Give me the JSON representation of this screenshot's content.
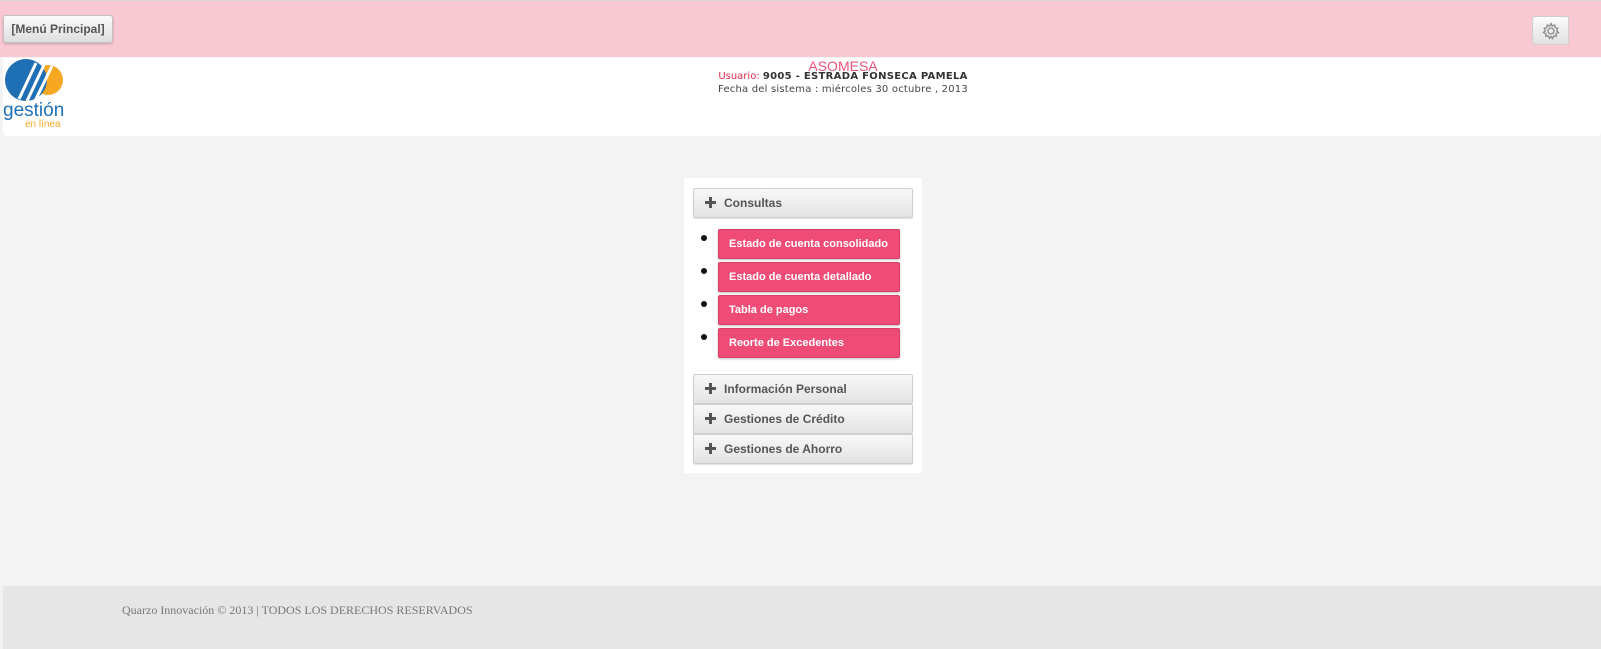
{
  "topbar": {
    "menu_button_label": "[Menú Principal]",
    "settings_icon": "gear-icon"
  },
  "header": {
    "logo": {
      "icon": "cloud-logo-icon",
      "title": "gestión",
      "subtitle": "en línea"
    },
    "org_name": "ASOMESA",
    "user_label": "Usuario:",
    "user_value": "9005 - ESTRADA FONSECA PAMELA",
    "date_line": "Fecha del sistema : miércoles 30 octubre , 2013"
  },
  "menu": {
    "sections": [
      {
        "label": "Consultas",
        "expanded": true,
        "items": [
          {
            "label": "Estado de cuenta consolidado"
          },
          {
            "label": "Estado de cuenta detallado"
          },
          {
            "label": "Tabla de pagos"
          },
          {
            "label": "Reorte de Excedentes"
          }
        ]
      },
      {
        "label": "Información Personal",
        "expanded": false
      },
      {
        "label": "Gestiones de Crédito",
        "expanded": false
      },
      {
        "label": "Gestiones de Ahorro",
        "expanded": false
      }
    ]
  },
  "footer": {
    "text": "Quarzo Innovación © 2013 | TODOS LOS DERECHOS RESERVADOS"
  },
  "colors": {
    "topbar": "#f8c8d3",
    "accent": "#ee4c76",
    "org_name": "#e8537a",
    "user_label": "#e0274a",
    "logo_blue": "#1f6fb4",
    "logo_orange": "#f7a823"
  }
}
